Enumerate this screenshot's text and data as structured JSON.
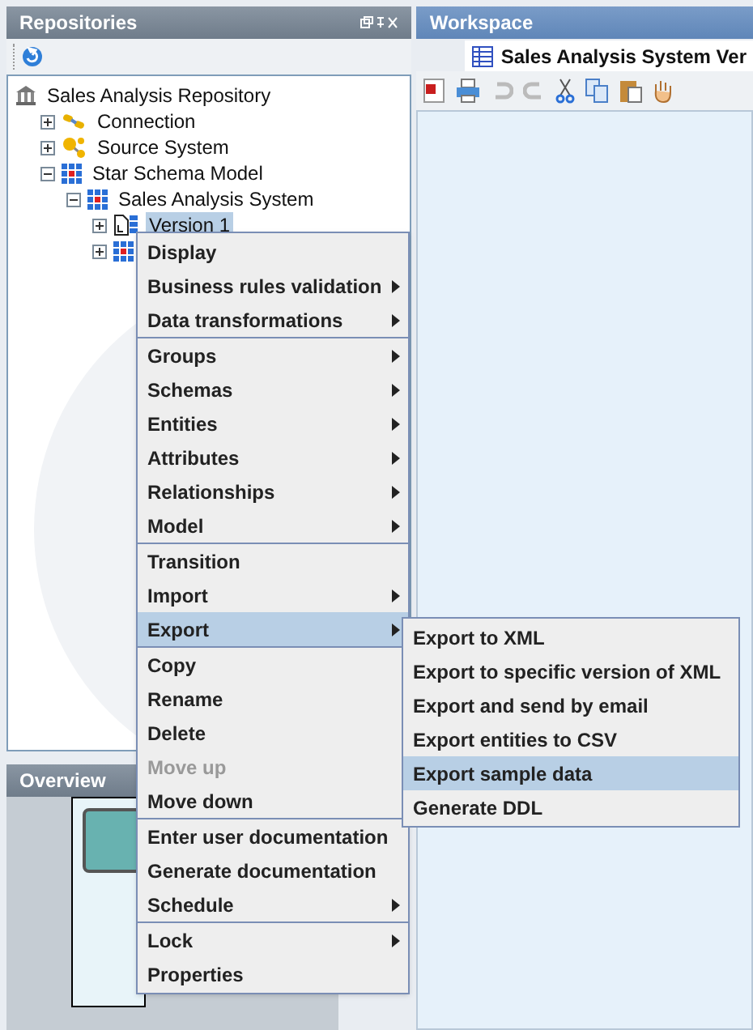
{
  "repositories": {
    "title": "Repositories",
    "tree": [
      {
        "label": "Sales Analysis Repository",
        "kind": "repository",
        "selected": false,
        "children": [
          {
            "label": "Connection",
            "kind": "connection",
            "expanded": false,
            "selected": false
          },
          {
            "label": "Source System",
            "kind": "source",
            "expanded": false,
            "selected": false
          },
          {
            "label": "Star Schema Model",
            "kind": "model",
            "expanded": true,
            "selected": false,
            "children": [
              {
                "label": "Sales Analysis System",
                "kind": "model",
                "expanded": true,
                "selected": false,
                "children": [
                  {
                    "label": "Version 1",
                    "kind": "version",
                    "expanded": false,
                    "selected": true
                  },
                  {
                    "kind": "model",
                    "expanded": false,
                    "selected": false
                  }
                ]
              }
            ]
          }
        ]
      }
    ]
  },
  "overview": {
    "title": "Overview"
  },
  "workspace": {
    "title": "Workspace",
    "tab": {
      "label": "Sales Analysis System Ver",
      "selected": true
    }
  },
  "context_menu": {
    "groups": [
      [
        {
          "label": "Display",
          "submenu": false,
          "disabled": false,
          "selected": false
        },
        {
          "label": "Business rules validation",
          "submenu": true,
          "disabled": false,
          "selected": false
        },
        {
          "label": "Data transformations",
          "submenu": true,
          "disabled": false,
          "selected": false
        }
      ],
      [
        {
          "label": "Groups",
          "submenu": true,
          "disabled": false,
          "selected": false
        },
        {
          "label": "Schemas",
          "submenu": true,
          "disabled": false,
          "selected": false
        },
        {
          "label": "Entities",
          "submenu": true,
          "disabled": false,
          "selected": false
        },
        {
          "label": "Attributes",
          "submenu": true,
          "disabled": false,
          "selected": false
        },
        {
          "label": "Relationships",
          "submenu": true,
          "disabled": false,
          "selected": false
        },
        {
          "label": "Model",
          "submenu": true,
          "disabled": false,
          "selected": false
        }
      ],
      [
        {
          "label": "Transition",
          "submenu": false,
          "disabled": false,
          "selected": false
        },
        {
          "label": "Import",
          "submenu": true,
          "disabled": false,
          "selected": false
        },
        {
          "label": "Export",
          "submenu": true,
          "disabled": false,
          "selected": true
        }
      ],
      [
        {
          "label": "Copy",
          "submenu": false,
          "disabled": false,
          "selected": false
        },
        {
          "label": "Rename",
          "submenu": false,
          "disabled": false,
          "selected": false
        },
        {
          "label": "Delete",
          "submenu": false,
          "disabled": false,
          "selected": false
        },
        {
          "label": "Move up",
          "submenu": false,
          "disabled": true,
          "selected": false
        },
        {
          "label": "Move down",
          "submenu": false,
          "disabled": false,
          "selected": false
        }
      ],
      [
        {
          "label": "Enter user documentation",
          "submenu": false,
          "disabled": false,
          "selected": false
        },
        {
          "label": "Generate documentation",
          "submenu": false,
          "disabled": false,
          "selected": false
        },
        {
          "label": "Schedule",
          "submenu": true,
          "disabled": false,
          "selected": false
        }
      ],
      [
        {
          "label": "Lock",
          "submenu": true,
          "disabled": false,
          "selected": false
        },
        {
          "label": "Properties",
          "submenu": false,
          "disabled": false,
          "selected": false
        }
      ]
    ]
  },
  "export_submenu": {
    "items": [
      {
        "label": "Export to XML",
        "selected": false
      },
      {
        "label": "Export to specific version of XML",
        "selected": false
      },
      {
        "label": "Export and send by email",
        "selected": false
      },
      {
        "label": "Export entities to CSV",
        "selected": false
      },
      {
        "label": "Export sample data",
        "selected": true
      },
      {
        "label": "Generate DDL",
        "selected": false
      }
    ]
  }
}
